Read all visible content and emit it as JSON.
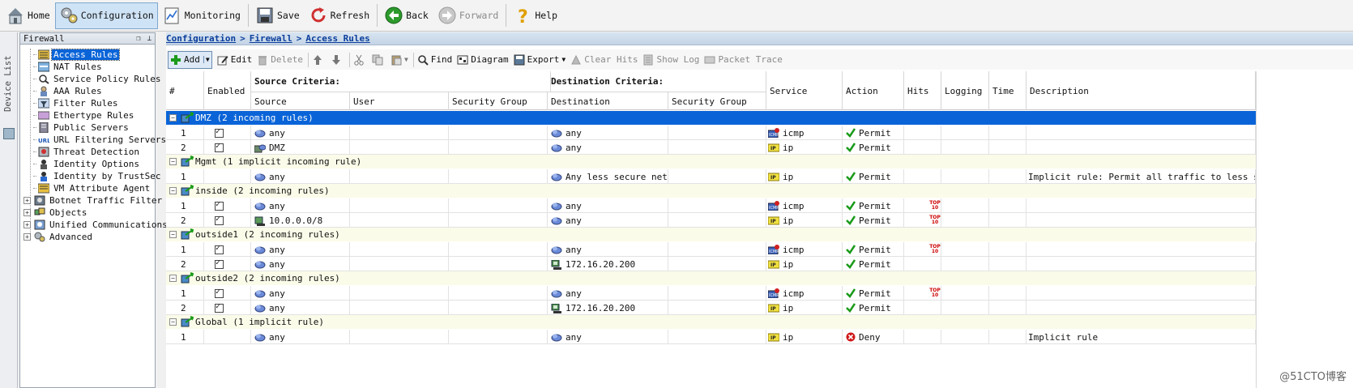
{
  "toolbar": {
    "home": "Home",
    "configuration": "Configuration",
    "monitoring": "Monitoring",
    "save": "Save",
    "refresh": "Refresh",
    "back": "Back",
    "forward": "Forward",
    "help": "Help"
  },
  "device_list": {
    "label": "Device List"
  },
  "nav": {
    "title": "Firewall",
    "items": [
      {
        "label": "Access Rules",
        "icon": "access-rules-icon",
        "selected": true
      },
      {
        "label": "NAT Rules",
        "icon": "nat-rules-icon"
      },
      {
        "label": "Service Policy Rules",
        "icon": "service-policy-icon"
      },
      {
        "label": "AAA Rules",
        "icon": "aaa-rules-icon"
      },
      {
        "label": "Filter Rules",
        "icon": "filter-rules-icon"
      },
      {
        "label": "Ethertype Rules",
        "icon": "ethertype-icon"
      },
      {
        "label": "Public Servers",
        "icon": "public-servers-icon"
      },
      {
        "label": "URL Filtering Servers",
        "icon": "url-icon"
      },
      {
        "label": "Threat Detection",
        "icon": "threat-detection-icon"
      },
      {
        "label": "Identity Options",
        "icon": "identity-icon"
      },
      {
        "label": "Identity by TrustSec",
        "icon": "trustsec-icon"
      },
      {
        "label": "VM Attribute Agent",
        "icon": "vm-agent-icon"
      },
      {
        "label": "Botnet Traffic Filter",
        "icon": "botnet-icon",
        "expandable": true
      },
      {
        "label": "Objects",
        "icon": "objects-icon",
        "expandable": true
      },
      {
        "label": "Unified Communications",
        "icon": "unified-comm-icon",
        "expandable": true
      },
      {
        "label": "Advanced",
        "icon": "advanced-icon",
        "expandable": true
      }
    ]
  },
  "breadcrumb": {
    "configuration": "Configuration",
    "firewall": "Firewall",
    "access_rules": "Access Rules",
    "separator": ">"
  },
  "actions": {
    "add": "Add",
    "edit": "Edit",
    "delete": "Delete",
    "find": "Find",
    "diagram": "Diagram",
    "export": "Export",
    "clear_hits": "Clear Hits",
    "show_log": "Show Log",
    "packet_trace": "Packet Trace"
  },
  "table": {
    "headers": {
      "num": "#",
      "enabled": "Enabled",
      "source_criteria": "Source Criteria:",
      "source": "Source",
      "user": "User",
      "src_security_group": "Security Group",
      "destination_criteria": "Destination Criteria:",
      "destination": "Destination",
      "dst_security_group": "Security Group",
      "service": "Service",
      "action": "Action",
      "hits": "Hits",
      "logging": "Logging",
      "time": "Time",
      "description": "Description"
    },
    "groups": [
      {
        "label": "DMZ (2 incoming rules)",
        "selected": true,
        "rules": [
          {
            "num": "1",
            "enabled": true,
            "source": "any",
            "src_icon": "network-cloud",
            "destination": "any",
            "dst_icon": "network-cloud",
            "service": "icmp",
            "svc_icon": "icmp",
            "action": "Permit",
            "hits": "",
            "description": ""
          },
          {
            "num": "2",
            "enabled": true,
            "source": "DMZ",
            "src_icon": "interface-network",
            "destination": "any",
            "dst_icon": "network-cloud",
            "service": "ip",
            "svc_icon": "ip",
            "action": "Permit",
            "hits": "",
            "description": ""
          }
        ]
      },
      {
        "label": "Mgmt (1 implicit incoming rule)",
        "rules": [
          {
            "num": "1",
            "enabled": false,
            "source": "any",
            "src_icon": "network-cloud",
            "destination": "Any less secure net...",
            "dst_icon": "network-cloud",
            "service": "ip",
            "svc_icon": "ip",
            "action": "Permit",
            "hits": "",
            "description": "Implicit rule: Permit all traffic to less secure..."
          }
        ]
      },
      {
        "label": "inside (2 incoming rules)",
        "rules": [
          {
            "num": "1",
            "enabled": true,
            "source": "any",
            "src_icon": "network-cloud",
            "destination": "any",
            "dst_icon": "network-cloud",
            "service": "icmp",
            "svc_icon": "icmp",
            "action": "Permit",
            "hits": "TOP 10",
            "description": ""
          },
          {
            "num": "2",
            "enabled": true,
            "source": "10.0.0.0/8",
            "src_icon": "network-object",
            "destination": "any",
            "dst_icon": "network-cloud",
            "service": "ip",
            "svc_icon": "ip",
            "action": "Permit",
            "hits": "TOP 10",
            "description": ""
          }
        ]
      },
      {
        "label": "outside1 (2 incoming rules)",
        "rules": [
          {
            "num": "1",
            "enabled": true,
            "source": "any",
            "src_icon": "network-cloud",
            "destination": "any",
            "dst_icon": "network-cloud",
            "service": "icmp",
            "svc_icon": "icmp",
            "action": "Permit",
            "hits": "TOP 10",
            "description": ""
          },
          {
            "num": "2",
            "enabled": true,
            "source": "any",
            "src_icon": "network-cloud",
            "destination": "172.16.20.200",
            "dst_icon": "host",
            "service": "ip",
            "svc_icon": "ip",
            "action": "Permit",
            "hits": "",
            "description": ""
          }
        ]
      },
      {
        "label": "outside2 (2 incoming rules)",
        "rules": [
          {
            "num": "1",
            "enabled": true,
            "source": "any",
            "src_icon": "network-cloud",
            "destination": "any",
            "dst_icon": "network-cloud",
            "service": "icmp",
            "svc_icon": "icmp",
            "action": "Permit",
            "hits": "TOP 10",
            "description": ""
          },
          {
            "num": "2",
            "enabled": true,
            "source": "any",
            "src_icon": "network-cloud",
            "destination": "172.16.20.200",
            "dst_icon": "host",
            "service": "ip",
            "svc_icon": "ip",
            "action": "Permit",
            "hits": "",
            "description": ""
          }
        ]
      },
      {
        "label": "Global (1 implicit rule)",
        "rules": [
          {
            "num": "1",
            "enabled": false,
            "source": "any",
            "src_icon": "network-cloud",
            "destination": "any",
            "dst_icon": "network-cloud",
            "service": "ip",
            "svc_icon": "ip",
            "action": "Deny",
            "hits": "",
            "description": "Implicit rule"
          }
        ]
      }
    ]
  },
  "watermark": "@51CTO博客",
  "colors": {
    "selection": "#0a64d8",
    "group_bg": "#fbfbe9",
    "permit": "#1a9a1a",
    "deny": "#d01818",
    "link": "#0b3e9c"
  }
}
